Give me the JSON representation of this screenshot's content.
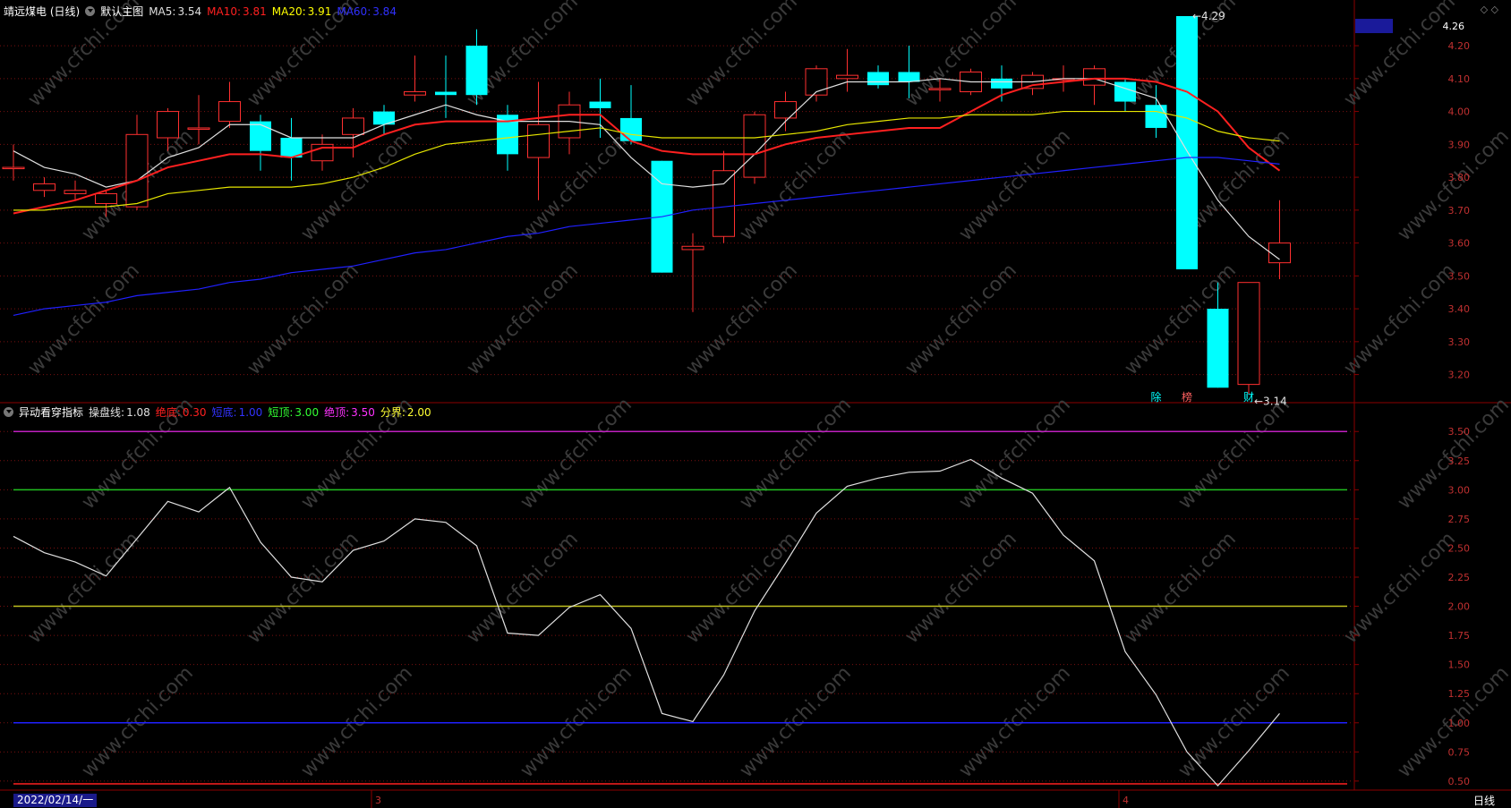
{
  "header_main": {
    "name": "靖远煤电 (日线)",
    "panel": "默认主图",
    "ma5": {
      "label": "MA5:",
      "value": "3.54",
      "color": "#e0e0e0"
    },
    "ma10": {
      "label": "MA10:",
      "value": "3.81",
      "color": "#ff2020"
    },
    "ma20": {
      "label": "MA20:",
      "value": "3.91",
      "color": "#ffff00"
    },
    "ma60": {
      "label": "MA60:",
      "value": "3.84",
      "color": "#2222ff"
    }
  },
  "header_ind": {
    "name": "异动看穿指标",
    "items": [
      {
        "label": "操盘线:",
        "value": "1.08",
        "color": "#e0e0e0"
      },
      {
        "label": "绝底:",
        "value": "0.30",
        "color": "#ff2020"
      },
      {
        "label": "短底:",
        "value": "1.00",
        "color": "#3333ff"
      },
      {
        "label": "短顶:",
        "value": "3.00",
        "color": "#33ff33"
      },
      {
        "label": "绝顶:",
        "value": "3.50",
        "color": "#ff33ff"
      },
      {
        "label": "分界:",
        "value": "2.00",
        "color": "#ffff33"
      }
    ]
  },
  "top_right_icons": "◇ ◇",
  "bottom": {
    "date": "2022/02/14/一",
    "month_marks": [
      "3",
      "4"
    ],
    "period": "日线"
  },
  "watermark": "www.cfchi.com",
  "chart_data": [
    {
      "type": "candlestick",
      "title": "",
      "ylim": [
        3.12,
        4.29
      ],
      "y_ticks": [
        "3.20",
        "3.30",
        "3.40",
        "3.50",
        "3.60",
        "3.70",
        "3.80",
        "3.90",
        "4.00",
        "4.10",
        "4.20"
      ],
      "current_price_label": "4.26",
      "annotations": [
        {
          "text": "←4.29",
          "candle": 38
        },
        {
          "text": "←3.14",
          "candle": 40
        }
      ],
      "markers": [
        {
          "text": "除",
          "candle": 37
        },
        {
          "text": "榜",
          "candle": 38
        },
        {
          "text": "财",
          "candle": 40
        }
      ],
      "candles": [
        [
          3.83,
          3.83,
          3.9,
          3.79
        ],
        [
          3.76,
          3.78,
          3.8,
          3.74
        ],
        [
          3.75,
          3.76,
          3.79,
          3.73
        ],
        [
          3.72,
          3.75,
          3.76,
          3.68
        ],
        [
          3.71,
          3.93,
          3.99,
          3.7
        ],
        [
          3.92,
          4.0,
          4.01,
          3.88
        ],
        [
          3.95,
          3.95,
          4.05,
          3.9
        ],
        [
          3.97,
          4.03,
          4.09,
          3.95
        ],
        [
          3.97,
          3.88,
          3.99,
          3.82
        ],
        [
          3.92,
          3.86,
          3.98,
          3.79
        ],
        [
          3.85,
          3.9,
          3.93,
          3.82
        ],
        [
          3.93,
          3.98,
          4.01,
          3.86
        ],
        [
          4.0,
          3.96,
          4.02,
          3.93
        ],
        [
          4.05,
          4.06,
          4.17,
          4.03
        ],
        [
          4.06,
          4.05,
          4.17,
          3.98
        ],
        [
          4.2,
          4.05,
          4.25,
          4.02
        ],
        [
          3.99,
          3.87,
          4.02,
          3.82
        ],
        [
          3.86,
          3.96,
          4.09,
          3.73
        ],
        [
          3.92,
          4.02,
          4.06,
          3.87
        ],
        [
          4.03,
          4.01,
          4.1,
          3.92
        ],
        [
          3.98,
          3.91,
          4.08,
          3.9
        ],
        [
          3.85,
          3.51,
          3.85,
          3.51
        ],
        [
          3.58,
          3.59,
          3.63,
          3.39
        ],
        [
          3.62,
          3.82,
          3.88,
          3.6
        ],
        [
          3.8,
          3.99,
          4.0,
          3.78
        ],
        [
          3.98,
          4.03,
          4.06,
          3.94
        ],
        [
          4.05,
          4.13,
          4.14,
          4.03
        ],
        [
          4.1,
          4.11,
          4.19,
          4.06
        ],
        [
          4.12,
          4.08,
          4.14,
          4.07
        ],
        [
          4.12,
          4.09,
          4.2,
          4.04
        ],
        [
          4.07,
          4.07,
          4.1,
          4.03
        ],
        [
          4.06,
          4.12,
          4.13,
          4.05
        ],
        [
          4.1,
          4.07,
          4.14,
          4.03
        ],
        [
          4.07,
          4.11,
          4.12,
          4.05
        ],
        [
          4.1,
          4.1,
          4.14,
          4.06
        ],
        [
          4.08,
          4.13,
          4.14,
          4.02
        ],
        [
          4.09,
          4.03,
          4.1,
          4.0
        ],
        [
          4.02,
          3.95,
          4.08,
          3.92
        ],
        [
          4.29,
          3.52,
          4.29,
          3.52
        ],
        [
          3.4,
          3.16,
          3.48,
          3.16
        ],
        [
          3.17,
          3.48,
          3.48,
          3.14
        ],
        [
          3.54,
          3.6,
          3.73,
          3.49
        ]
      ],
      "series": [
        {
          "name": "MA5",
          "color": "#e0e0e0",
          "values": [
            3.88,
            3.83,
            3.81,
            3.77,
            3.79,
            3.86,
            3.89,
            3.96,
            3.96,
            3.92,
            3.92,
            3.92,
            3.96,
            3.99,
            4.02,
            3.99,
            3.97,
            3.97,
            3.97,
            3.96,
            3.86,
            3.78,
            3.77,
            3.78,
            3.87,
            3.97,
            4.06,
            4.09,
            4.09,
            4.09,
            4.1,
            4.09,
            4.09,
            4.09,
            4.1,
            4.1,
            4.07,
            4.04,
            3.88,
            3.73,
            3.62,
            3.55
          ]
        },
        {
          "name": "MA10",
          "color": "#ff2020",
          "values": [
            3.69,
            3.71,
            3.73,
            3.76,
            3.79,
            3.83,
            3.85,
            3.87,
            3.87,
            3.86,
            3.89,
            3.89,
            3.93,
            3.96,
            3.97,
            3.97,
            3.97,
            3.98,
            3.99,
            3.99,
            3.91,
            3.88,
            3.87,
            3.87,
            3.87,
            3.9,
            3.92,
            3.93,
            3.94,
            3.95,
            3.95,
            4.0,
            4.05,
            4.08,
            4.09,
            4.1,
            4.1,
            4.09,
            4.06,
            4.0,
            3.89,
            3.82
          ]
        },
        {
          "name": "MA20",
          "color": "#e6e600",
          "values": [
            3.7,
            3.7,
            3.71,
            3.71,
            3.72,
            3.75,
            3.76,
            3.77,
            3.77,
            3.77,
            3.78,
            3.8,
            3.83,
            3.87,
            3.9,
            3.91,
            3.92,
            3.93,
            3.94,
            3.95,
            3.93,
            3.92,
            3.92,
            3.92,
            3.92,
            3.93,
            3.94,
            3.96,
            3.97,
            3.98,
            3.98,
            3.99,
            3.99,
            3.99,
            4.0,
            4.0,
            4.0,
            4.0,
            3.98,
            3.94,
            3.92,
            3.91
          ]
        },
        {
          "name": "MA60",
          "color": "#2020ff",
          "values": [
            3.38,
            3.4,
            3.41,
            3.42,
            3.44,
            3.45,
            3.46,
            3.48,
            3.49,
            3.51,
            3.52,
            3.53,
            3.55,
            3.57,
            3.58,
            3.6,
            3.62,
            3.63,
            3.65,
            3.66,
            3.67,
            3.68,
            3.7,
            3.71,
            3.72,
            3.73,
            3.74,
            3.75,
            3.76,
            3.77,
            3.78,
            3.79,
            3.8,
            3.81,
            3.82,
            3.83,
            3.84,
            3.85,
            3.86,
            3.86,
            3.85,
            3.84
          ]
        }
      ]
    },
    {
      "type": "line",
      "title": "",
      "ylim": [
        0.43,
        3.64
      ],
      "y_ticks": [
        "0.50",
        "0.75",
        "1.00",
        "1.25",
        "1.50",
        "1.75",
        "2.00",
        "2.25",
        "2.50",
        "2.75",
        "3.00",
        "3.25",
        "3.50"
      ],
      "hlines": [
        {
          "value": 3.5,
          "color": "#c020c0"
        },
        {
          "value": 3.0,
          "color": "#20c020"
        },
        {
          "value": 2.0,
          "color": "#c0c020"
        },
        {
          "value": 1.0,
          "color": "#2020ff"
        },
        {
          "value": 0.3,
          "color": "#ff2020"
        }
      ],
      "series": [
        {
          "name": "操盘线",
          "color": "#e0e0e0",
          "values": [
            2.6,
            2.46,
            2.38,
            2.26,
            2.58,
            2.9,
            2.81,
            3.02,
            2.55,
            2.25,
            2.21,
            2.48,
            2.56,
            2.75,
            2.72,
            2.52,
            1.77,
            1.75,
            1.99,
            2.1,
            1.81,
            1.08,
            1.01,
            1.41,
            1.96,
            2.37,
            2.8,
            3.03,
            3.1,
            3.15,
            3.16,
            3.26,
            3.1,
            2.97,
            2.61,
            2.39,
            1.61,
            1.24,
            0.75,
            0.46,
            0.76,
            1.08
          ]
        }
      ]
    }
  ]
}
